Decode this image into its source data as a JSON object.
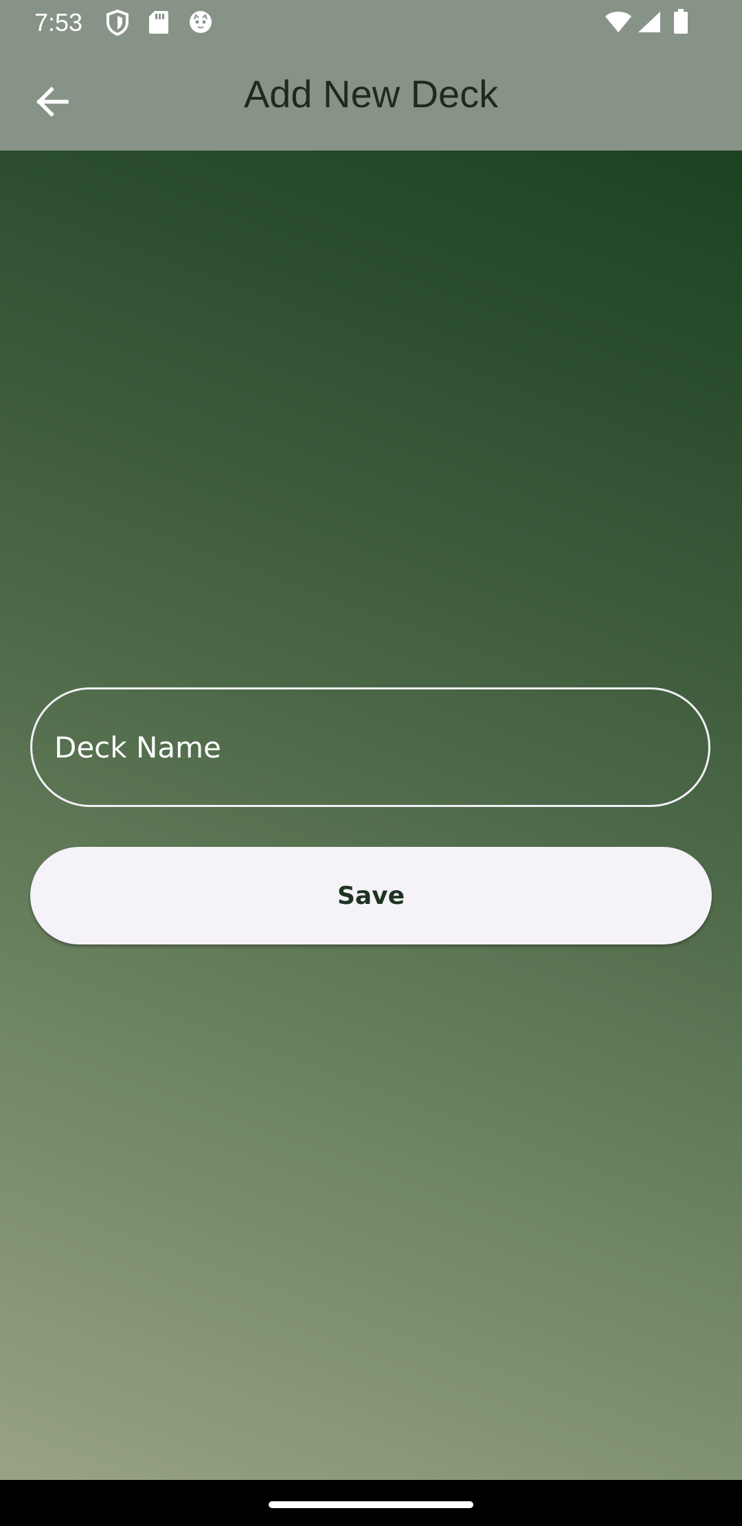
{
  "status_bar": {
    "time": "7:53",
    "left_icons": [
      "shield-icon",
      "sd-card-icon",
      "cat-face-icon"
    ],
    "right_icons": [
      "wifi-icon",
      "cellular-signal-icon",
      "battery-icon"
    ]
  },
  "app_bar": {
    "back_icon": "arrow-back-icon",
    "title": "Add New Deck"
  },
  "form": {
    "deck_name_placeholder": "Deck Name",
    "deck_name_value": "",
    "save_label": "Save"
  },
  "colors": {
    "top_bar": "#889388",
    "gradient_dark": "#133a1a",
    "gradient_light": "#98a383",
    "button_bg": "#f5f2f8",
    "button_text": "#1f3323"
  }
}
